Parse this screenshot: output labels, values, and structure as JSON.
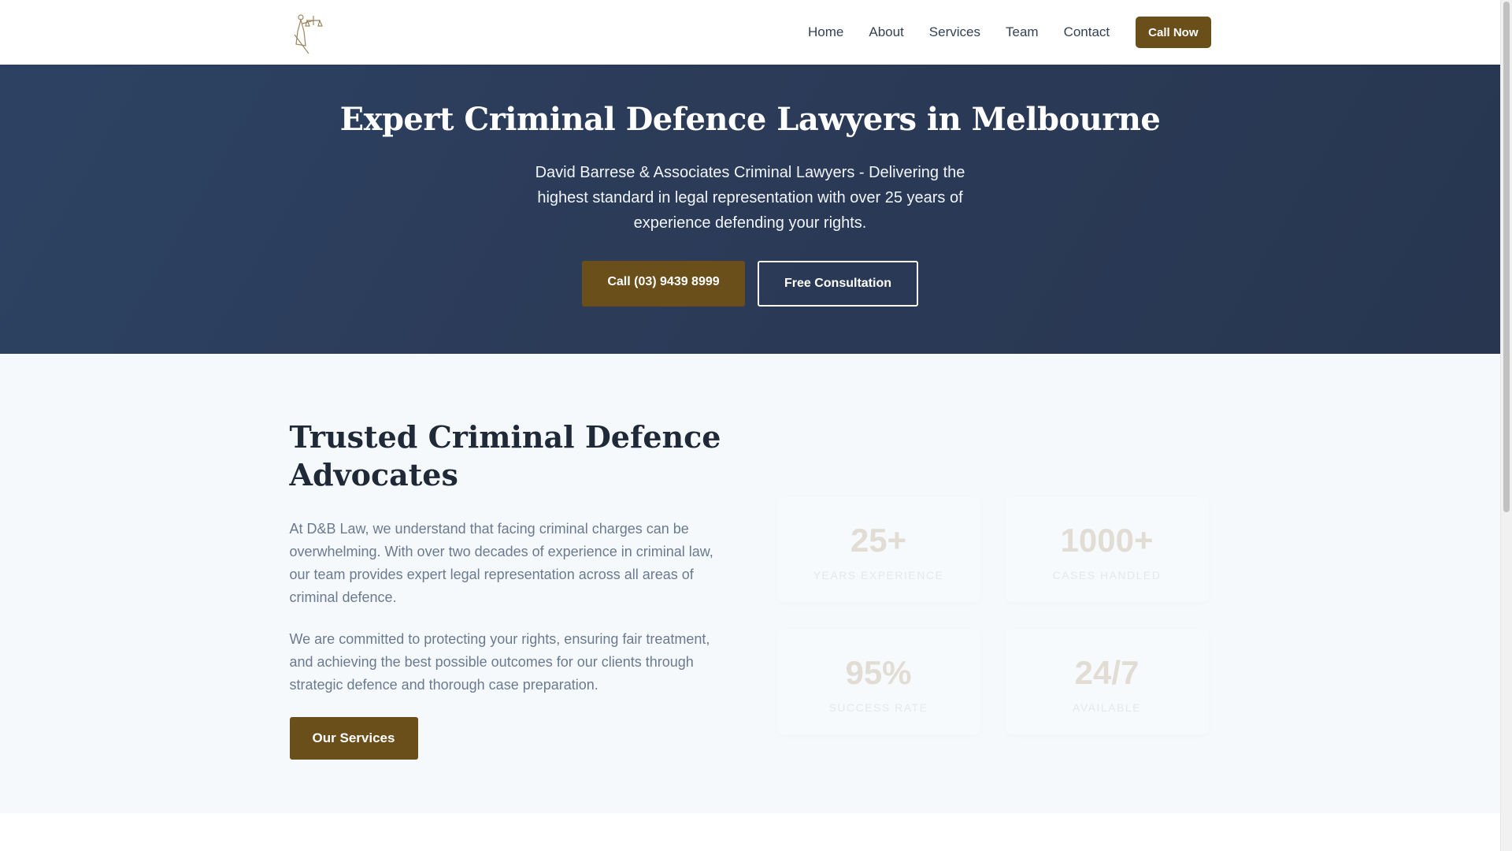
{
  "header": {
    "logo_alt": "Lady Justice logo",
    "nav": [
      "Home",
      "About",
      "Services",
      "Team",
      "Contact"
    ],
    "cta": "Call Now"
  },
  "hero": {
    "title": "Expert Criminal Defence Lawyers in Melbourne",
    "subtitle": "David Barrese & Associates Criminal Lawyers - Delivering the highest standard in legal representation with over 25 years of experience defending your rights.",
    "call_button": "Call (03) 9439 8999",
    "consult_button": "Free Consultation"
  },
  "about": {
    "title": "Trusted Criminal Defence Advocates",
    "paragraphs": [
      "At D&B Law, we understand that facing criminal charges can be overwhelming. With over two decades of experience in criminal law, our team provides expert legal representation across all areas of criminal defence.",
      "We are committed to protecting your rights, ensuring fair treatment, and achieving the best possible outcomes for our clients through strategic defence and thorough case preparation."
    ],
    "button": "Our Services",
    "stats": [
      {
        "value": "25+",
        "label": "YEARS EXPERIENCE"
      },
      {
        "value": "1000+",
        "label": "CASES HANDLED"
      },
      {
        "value": "95%",
        "label": "SUCCESS RATE"
      },
      {
        "value": "24/7",
        "label": "AVAILABLE"
      }
    ]
  },
  "colors": {
    "accent": "#6b4f1a",
    "hero": "#2b3b58"
  }
}
